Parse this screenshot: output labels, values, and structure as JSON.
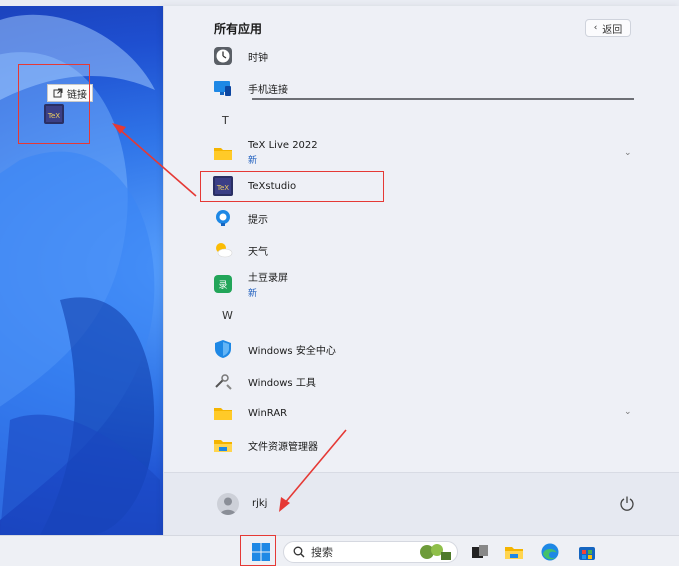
{
  "start_menu": {
    "title": "所有应用",
    "back_label": "返回",
    "items": [
      {
        "label": "时钟",
        "sub": "",
        "icon": "clock-icon"
      },
      {
        "label": "手机连接",
        "sub": "",
        "icon": "phone-link-icon"
      },
      {
        "label": "TeX Live 2022",
        "sub": "新",
        "icon": "folder-icon"
      },
      {
        "label": "TeXstudio",
        "sub": "",
        "icon": "texstudio-icon"
      },
      {
        "label": "提示",
        "sub": "",
        "icon": "tips-icon"
      },
      {
        "label": "天气",
        "sub": "",
        "icon": "weather-icon"
      },
      {
        "label": "土豆录屏",
        "sub": "新",
        "icon": "recorder-icon"
      },
      {
        "label": "Windows 安全中心",
        "sub": "",
        "icon": "security-shield-icon"
      },
      {
        "label": "Windows 工具",
        "sub": "",
        "icon": "windows-tools-icon"
      },
      {
        "label": "WinRAR",
        "sub": "",
        "icon": "folder-icon"
      },
      {
        "label": "文件资源管理器",
        "sub": "",
        "icon": "file-explorer-icon"
      }
    ],
    "letters": {
      "t": "T",
      "w": "W"
    },
    "user_name": "rjkj"
  },
  "desktop": {
    "tooltip_label": "链接",
    "shortcut_icon": "texstudio-icon",
    "shortcut_badge": "TeX"
  },
  "taskbar": {
    "search_label": "搜索",
    "icons": [
      "start-icon",
      "search-icon",
      "task-view-icon",
      "file-explorer-icon",
      "edge-icon",
      "store-icon"
    ]
  },
  "colors": {
    "highlight_box": "#e53935",
    "accent_new": "#1f5fbf",
    "wallpaper": "#2f74e8"
  }
}
